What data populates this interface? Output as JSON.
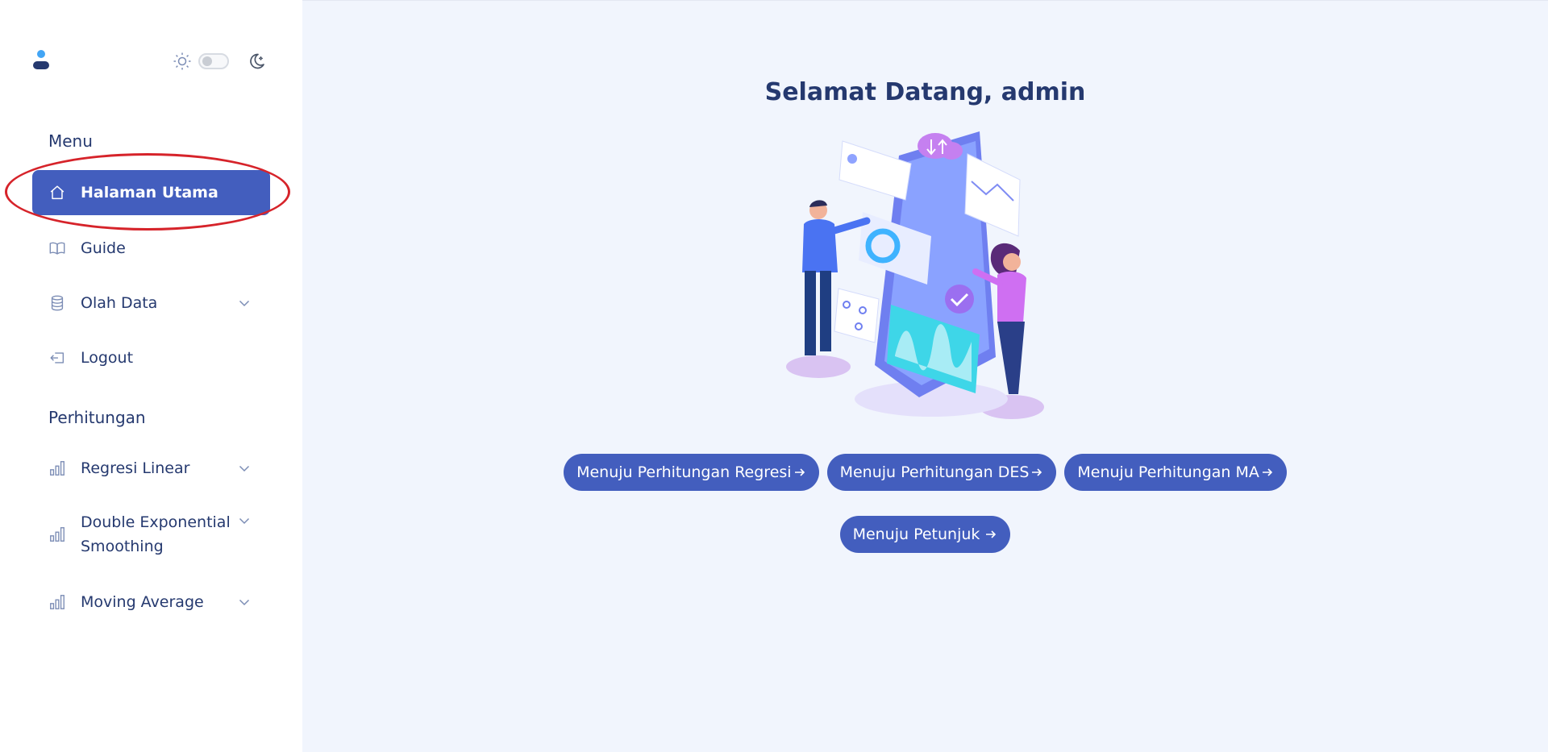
{
  "sidebar": {
    "menu_title": "Menu",
    "menu_items": [
      {
        "label": "Halaman Utama",
        "icon": "house-icon",
        "active": true
      },
      {
        "label": "Guide",
        "icon": "book-icon"
      },
      {
        "label": "Olah Data",
        "icon": "database-icon",
        "has_submenu": true
      },
      {
        "label": "Logout",
        "icon": "logout-icon"
      }
    ],
    "calc_title": "Perhitungan",
    "calc_items": [
      {
        "label": "Regresi Linear",
        "icon": "bar-chart-icon",
        "has_submenu": true
      },
      {
        "label": "Double Exponential",
        "label_line2": "Smoothing",
        "icon": "bar-chart-icon",
        "has_submenu": true
      },
      {
        "label": "Moving Average",
        "icon": "bar-chart-icon",
        "has_submenu": true
      }
    ]
  },
  "theme_toggle": {
    "state": "light"
  },
  "main": {
    "welcome": "Selamat Datang, admin",
    "buttons": [
      {
        "label": "Menuju Perhitungan Regresi"
      },
      {
        "label": "Menuju Perhitungan DES"
      },
      {
        "label": "Menuju Perhitungan MA"
      },
      {
        "label": "Menuju Petunjuk"
      }
    ]
  },
  "colors": {
    "primary": "#435ebe",
    "text": "#25396f",
    "main_bg": "#f1f5fd",
    "annotation": "#d6232a"
  }
}
